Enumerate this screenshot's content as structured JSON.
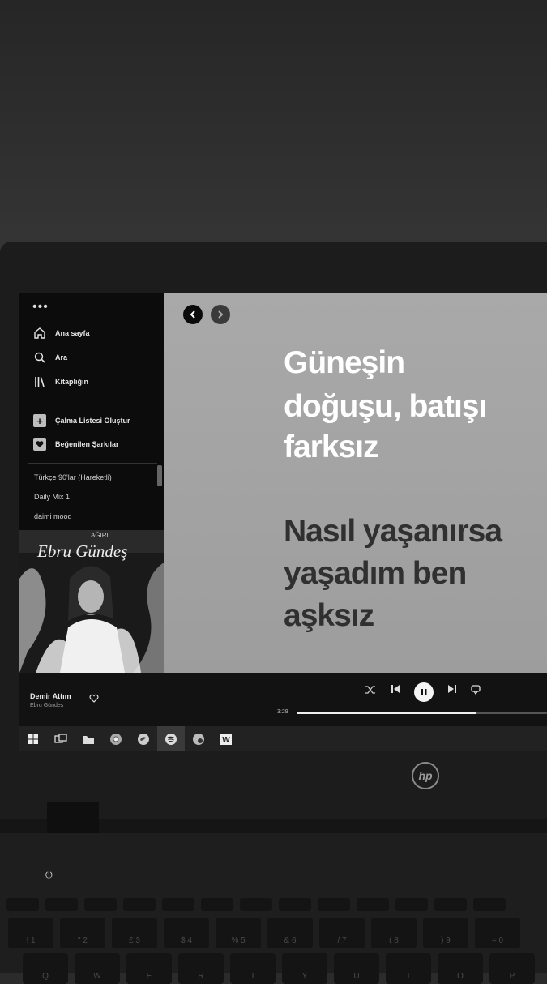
{
  "sidebar": {
    "menu_dots": "•••",
    "nav": [
      {
        "label": "Ana sayfa",
        "icon": "home-icon"
      },
      {
        "label": "Ara",
        "icon": "search-icon"
      },
      {
        "label": "Kitaplığın",
        "icon": "library-icon"
      }
    ],
    "actions": [
      {
        "label": "Çalma Listesi Oluştur",
        "icon": "plus-icon"
      },
      {
        "label": "Beğenilen Şarkılar",
        "icon": "heart-icon"
      }
    ],
    "playlists": [
      "Türkçe 90'lar (Hareketli)",
      "Daily Mix 1",
      "daimi mood"
    ],
    "cover_art": {
      "artist_text": "Ebru Gündeş",
      "top_text": "AĞIRI"
    }
  },
  "lyrics": {
    "active_lines": [
      "Güneşin",
      "doğuşu, batışı",
      "farksız"
    ],
    "next_lines": [
      "Nasıl yaşanırsa",
      "yaşadım ben",
      "aşksız"
    ]
  },
  "player": {
    "track_title": "Demir Attım",
    "artist": "Ebru Gündeş",
    "elapsed": "3:29",
    "progress": 0.72
  },
  "taskbar": {
    "apps": [
      "windows-start-icon",
      "task-view-icon",
      "file-explorer-icon",
      "chrome-icon",
      "edge-icon",
      "spotify-icon",
      "camera-app-icon",
      "word-icon"
    ],
    "active_app": "spotify-icon"
  },
  "laptop": {
    "brand": "hp",
    "number_keys": [
      "!",
      "1",
      "\"",
      "2",
      "£",
      "3",
      "$",
      "4",
      "%",
      "5",
      "&",
      "6",
      "/",
      "7",
      "(",
      "8",
      ")",
      "9",
      "=",
      "0"
    ],
    "letter_keys": [
      "Q",
      "W",
      "E",
      "R",
      "T",
      "Y",
      "U",
      "I",
      "O",
      "P"
    ]
  }
}
